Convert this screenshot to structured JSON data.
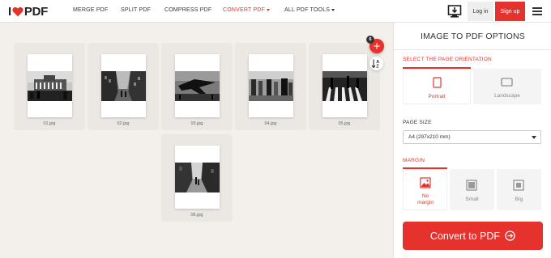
{
  "nav": {
    "logo_text": "PDF",
    "links": [
      "MERGE PDF",
      "SPLIT PDF",
      "COMPRESS PDF",
      "CONVERT PDF",
      "ALL PDF TOOLS"
    ],
    "login": "Log in",
    "signup": "Sign up"
  },
  "files": {
    "badge_count": "6",
    "add_symbol": "+",
    "items": [
      {
        "name": "01.jpg",
        "scene": "building"
      },
      {
        "name": "02.jpg",
        "scene": "street"
      },
      {
        "name": "03.jpg",
        "scene": "airplane"
      },
      {
        "name": "04.jpg",
        "scene": "crowd"
      },
      {
        "name": "05.jpg",
        "scene": "crosswalk"
      },
      {
        "name": "06.jpg",
        "scene": "alley"
      }
    ]
  },
  "sidebar": {
    "title": "IMAGE TO PDF OPTIONS",
    "orientation_label": "SELECT THE PAGE ORIENTATION",
    "orientation_options": [
      "Portrait",
      "Landscape"
    ],
    "orientation_selected": "Portrait",
    "page_size_label": "PAGE SIZE",
    "page_size_value": "A4 (297x210 mm)",
    "margin_label": "MARGIN",
    "margin_options": [
      "No margin",
      "Small",
      "Big"
    ],
    "margin_selected": "No margin",
    "convert_label": "Convert to PDF"
  },
  "colors": {
    "accent": "#e5322d",
    "background": "#f3f0ec",
    "card": "#ebe8e4"
  },
  "icons": [
    "heart-icon",
    "download-app-icon",
    "hamburger-menu-icon",
    "plus-icon",
    "sort-az-icon",
    "portrait-page-icon",
    "landscape-page-icon",
    "no-margin-icon",
    "small-margin-icon",
    "big-margin-icon",
    "arrow-circle-right-icon"
  ]
}
